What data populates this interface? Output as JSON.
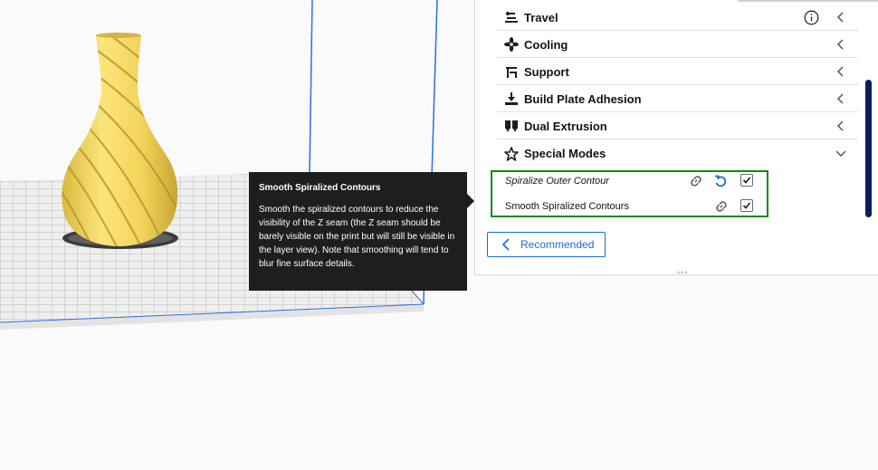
{
  "viewport": {
    "model_color": "#f3d85a",
    "build_volume_edge_color": "#2f6fe0"
  },
  "settings_panel": {
    "categories": [
      {
        "label": "Travel",
        "icon": "travel-icon",
        "has_info": true,
        "expanded": false
      },
      {
        "label": "Cooling",
        "icon": "fan-icon",
        "has_info": false,
        "expanded": false
      },
      {
        "label": "Support",
        "icon": "support-icon",
        "has_info": false,
        "expanded": false
      },
      {
        "label": "Build Plate Adhesion",
        "icon": "adhesion-icon",
        "has_info": false,
        "expanded": false
      },
      {
        "label": "Dual Extrusion",
        "icon": "dual-extrusion-icon",
        "has_info": false,
        "expanded": false
      },
      {
        "label": "Special Modes",
        "icon": "star-icon",
        "has_info": false,
        "expanded": true
      }
    ],
    "special_modes_settings": [
      {
        "label": "Spiralize Outer Contour",
        "italic": true,
        "checked": true,
        "has_reset": true
      },
      {
        "label": "Smooth Spiralized Contours",
        "italic": false,
        "checked": true,
        "has_reset": false
      }
    ],
    "highlight_color": "#128c11",
    "recommended_button": "Recommended",
    "accent_color": "#1b6ad5"
  },
  "tooltip": {
    "title": "Smooth Spiralized Contours",
    "body": "Smooth the spiralized contours to reduce the visibility of the Z seam (the Z seam should be barely visible on the print but will still be visible in the layer view). Note that smoothing will tend to blur fine surface details."
  }
}
